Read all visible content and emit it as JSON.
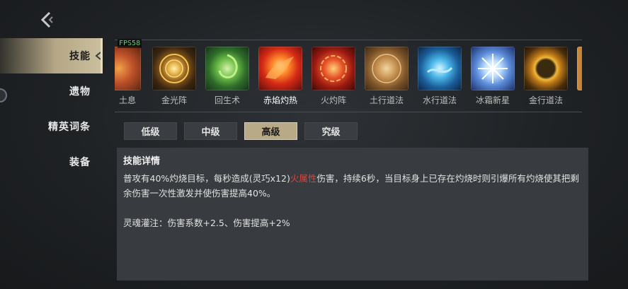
{
  "nav": {
    "items": [
      {
        "label": "技能",
        "active": true
      },
      {
        "label": "遗物",
        "active": false
      },
      {
        "label": "精英词条",
        "active": false
      },
      {
        "label": "装备",
        "active": false
      }
    ]
  },
  "overlay": {
    "fps": "FPS58"
  },
  "skills": [
    {
      "label": "土息",
      "icon": "earth-breath-icon"
    },
    {
      "label": "金光阵",
      "icon": "golden-light-array-icon"
    },
    {
      "label": "回生术",
      "icon": "revival-art-icon"
    },
    {
      "label": "赤焰灼热",
      "icon": "crimson-flame-scorch-icon",
      "selected": true
    },
    {
      "label": "火灼阵",
      "icon": "fire-burn-array-icon"
    },
    {
      "label": "土行道法",
      "icon": "earth-taoism-icon"
    },
    {
      "label": "水行道法",
      "icon": "water-taoism-icon"
    },
    {
      "label": "冰霜新星",
      "icon": "frost-nova-icon"
    },
    {
      "label": "金行道法",
      "icon": "metal-taoism-icon"
    }
  ],
  "tabs": [
    {
      "label": "低级",
      "active": false
    },
    {
      "label": "中级",
      "active": false
    },
    {
      "label": "高级",
      "active": true
    },
    {
      "label": "究级",
      "active": false
    }
  ],
  "detail": {
    "title": "技能详情",
    "desc_part1": "普攻有40%灼烧目标，每秒造成(灵巧x12)",
    "desc_highlight": "火属性",
    "desc_part2": "伤害，持续6秒，当目标身上已存在灼烧时则引爆所有灼烧使其把剩余伤害一次性激发并使伤害提高40%。",
    "bonus": "灵魂灌注：伤害系数+2.5、伤害提高+2%"
  },
  "colors": {
    "accent": "#b8aa86",
    "highlight": "#e0413a",
    "fps": "#5fd36b"
  }
}
